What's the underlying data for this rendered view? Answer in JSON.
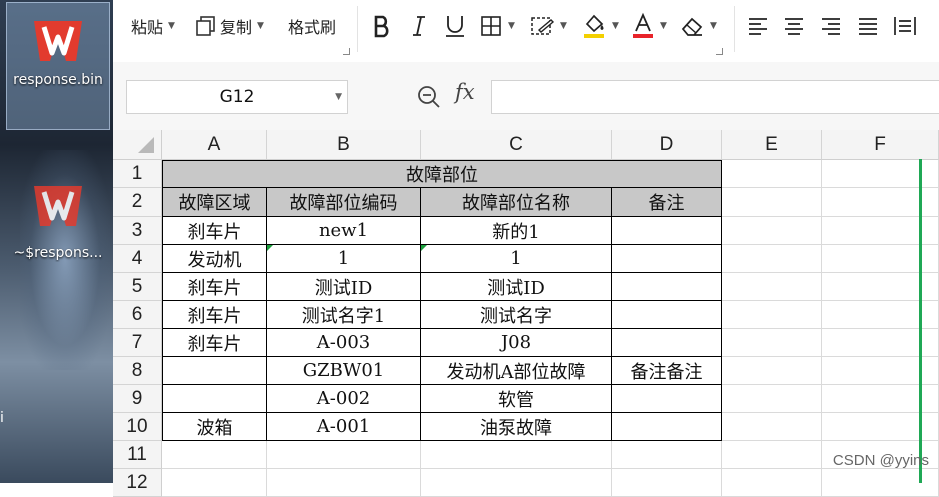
{
  "desktop": {
    "icon1_label": "response.bin",
    "icon2_label": "~$respons...",
    "edge_char": "i"
  },
  "ribbon": {
    "paste": "粘贴",
    "copy": "复制",
    "format_painter": "格式刷"
  },
  "formula_bar": {
    "name_box": "G12",
    "fx": "fx",
    "formula_value": ""
  },
  "columns": [
    "A",
    "B",
    "C",
    "D",
    "E",
    "F"
  ],
  "rows": [
    "1",
    "2",
    "3",
    "4",
    "5",
    "6",
    "7",
    "8",
    "9",
    "10",
    "11",
    "12"
  ],
  "table": {
    "title": "故障部位",
    "headers": [
      "故障区域",
      "故障部位编码",
      "故障部位名称",
      "备注"
    ],
    "data": [
      [
        "刹车片",
        "new1",
        "新的1",
        ""
      ],
      [
        "发动机",
        "1",
        "1",
        ""
      ],
      [
        "刹车片",
        "测试ID",
        "测试ID",
        ""
      ],
      [
        "刹车片",
        "测试名字1",
        "测试名字",
        ""
      ],
      [
        "刹车片",
        "A-003",
        "J08",
        ""
      ],
      [
        "",
        "GZBW01",
        "发动机A部位故障",
        "备注备注"
      ],
      [
        "",
        "A-002",
        "软管",
        ""
      ],
      [
        "波箱",
        "A-001",
        "油泵故障",
        ""
      ]
    ]
  },
  "watermark": "CSDN @yyins",
  "colors": {
    "header_fill": "#c8c8c8",
    "selection_green": "#1fa855",
    "wps_red": "#e23b2e"
  }
}
